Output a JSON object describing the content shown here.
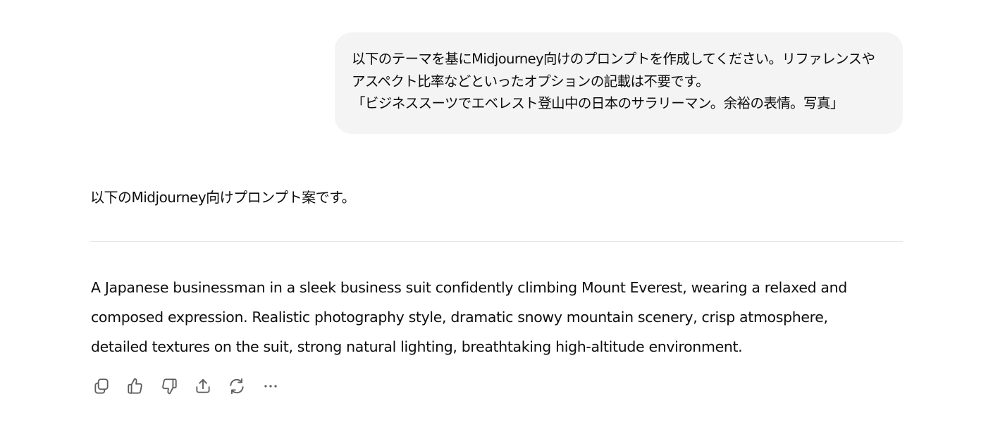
{
  "conversation": {
    "user_message": {
      "lines": [
        "以下のテーマを基にMidjourney向けのプロンプトを作成してください。リファレンスや",
        "アスペクト比率などといったオプションの記載は不要です。",
        "「ビジネススーツでエベレスト登山中の日本のサラリーマン。余裕の表情。写真」"
      ]
    },
    "assistant_message": {
      "intro": "以下のMidjourney向けプロンプト案です。",
      "prompt_lines": [
        "A Japanese businessman in a sleek business suit confidently climbing Mount Everest, wearing a relaxed and",
        "composed expression. Realistic photography style, dramatic snowy mountain scenery, crisp atmosphere,",
        "detailed textures on the suit, strong natural lighting, breathtaking high-altitude environment."
      ]
    },
    "actions": [
      {
        "name": "copy",
        "icon": "copy-icon"
      },
      {
        "name": "good-response",
        "icon": "thumbs-up-icon"
      },
      {
        "name": "bad-response",
        "icon": "thumbs-down-icon"
      },
      {
        "name": "share",
        "icon": "share-icon"
      },
      {
        "name": "regenerate",
        "icon": "regenerate-icon"
      },
      {
        "name": "more",
        "icon": "more-icon"
      }
    ]
  },
  "colors": {
    "text": "#0d0d0d",
    "user_bubble_bg": "#f4f4f4",
    "divider": "#e5e5e5",
    "icon": "#5d5d5d"
  }
}
